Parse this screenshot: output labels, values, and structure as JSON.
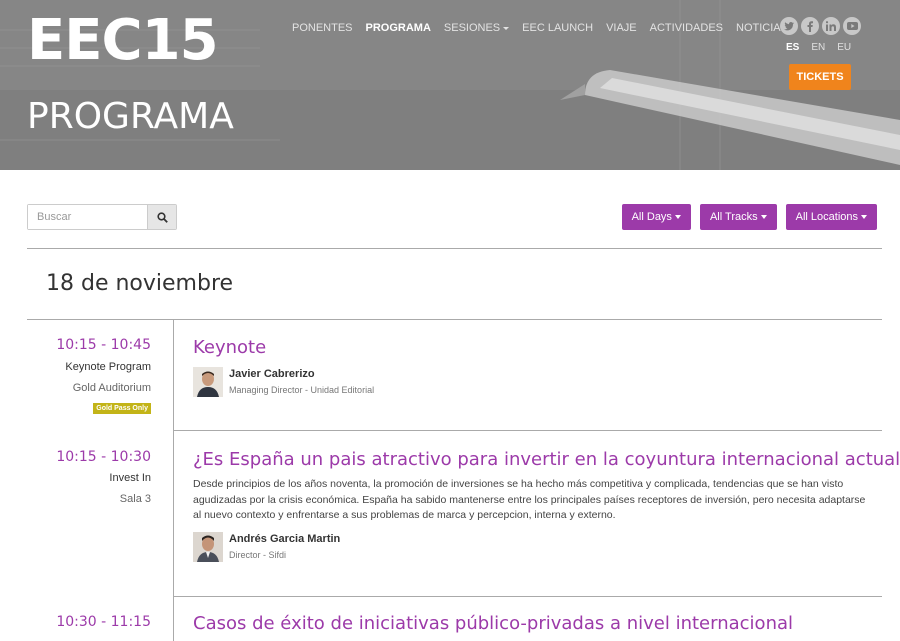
{
  "header": {
    "logo": "EEC15",
    "page_title": "PROGRAMA",
    "nav": [
      {
        "label": "PONENTES"
      },
      {
        "label": "PROGRAMA"
      },
      {
        "label": "SESIONES"
      },
      {
        "label": "EEC LAUNCH"
      },
      {
        "label": "VIAJE"
      },
      {
        "label": "ACTIVIDADES"
      },
      {
        "label": "NOTICIAS"
      }
    ],
    "active_nav": "PROGRAMA",
    "social_icons": [
      "twitter-icon",
      "facebook-icon",
      "linkedin-icon",
      "youtube-icon"
    ],
    "languages": [
      "ES",
      "EN",
      "EU"
    ],
    "active_language": "ES",
    "tickets_label": "TICKETS",
    "colors": {
      "tickets": "#f0841c",
      "accent": "#9c3aa9",
      "badge": "#c3b418"
    }
  },
  "toolbar": {
    "search_placeholder": "Buscar",
    "filters": [
      {
        "label": "All Days"
      },
      {
        "label": "All Tracks"
      },
      {
        "label": "All Locations"
      }
    ]
  },
  "schedule": {
    "day_title": "18 de noviembre",
    "sessions": [
      {
        "time": "10:15 - 10:45",
        "track": "Keynote Program",
        "location": "Gold Auditorium",
        "badge": "Gold Pass Only",
        "title": "Keynote",
        "speakers": [
          {
            "name": "Javier Cabrerizo",
            "role": "Managing Director - Unidad Editorial"
          }
        ]
      },
      {
        "time": "10:15 - 10:30",
        "track": "Invest In",
        "location": "Sala 3",
        "title": "¿Es España un pais atractivo para invertir en la coyuntura internacional actual?",
        "description": "Desde principios de los años noventa, la promoción de inversiones se ha hecho más competitiva y complicada, tendencias que se han visto agudizadas por la crisis económica. España ha sabido mantenerse entre los principales países receptores de inversión, pero necesita adaptarse al nuevo contexto y enfrentarse a sus problemas de marca y percepcion, interna y externo.",
        "speakers": [
          {
            "name": "Andrés Garcia Martin",
            "role": "Director - Sifdi"
          }
        ]
      },
      {
        "time": "10:30 - 11:15",
        "title": "Casos de éxito de iniciativas público-privadas a nivel internacional"
      }
    ]
  }
}
